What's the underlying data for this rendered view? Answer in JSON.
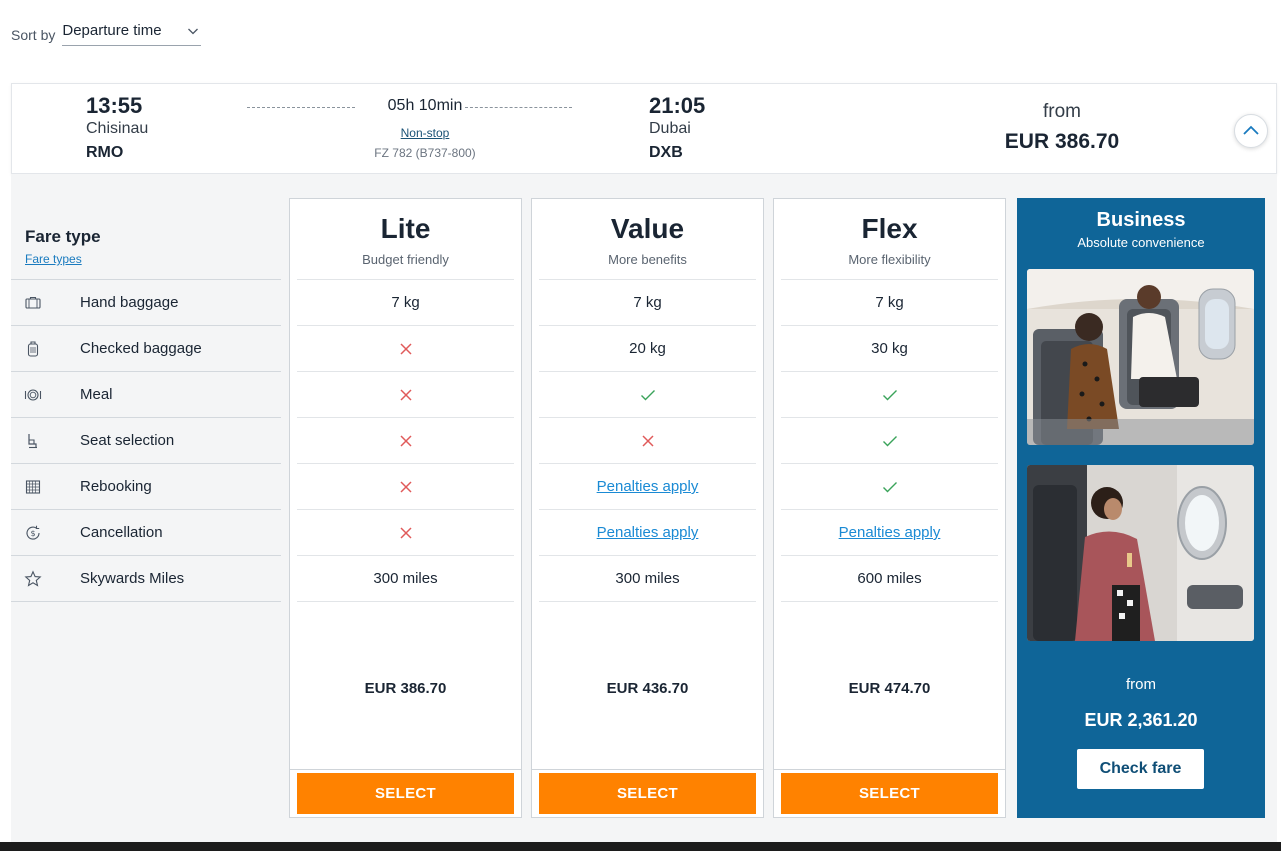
{
  "sort": {
    "label": "Sort by",
    "value": "Departure time"
  },
  "flight": {
    "departure": {
      "time": "13:55",
      "city": "Chisinau",
      "code": "RMO"
    },
    "arrival": {
      "time": "21:05",
      "city": "Dubai",
      "code": "DXB"
    },
    "duration": "05h 10min",
    "stops": "Non-stop",
    "flight_number": "FZ 782 (B737-800)",
    "from_label": "from",
    "from_price": "EUR 386.70"
  },
  "fare_header": {
    "title": "Fare type",
    "link": "Fare types"
  },
  "features": [
    {
      "label": "Hand baggage",
      "icon": "hand-baggage-icon"
    },
    {
      "label": "Checked baggage",
      "icon": "checked-baggage-icon"
    },
    {
      "label": "Meal",
      "icon": "meal-icon"
    },
    {
      "label": "Seat selection",
      "icon": "seat-icon"
    },
    {
      "label": "Rebooking",
      "icon": "calendar-icon"
    },
    {
      "label": "Cancellation",
      "icon": "refund-icon"
    },
    {
      "label": "Skywards Miles",
      "icon": "star-icon"
    }
  ],
  "fares": [
    {
      "name": "Lite",
      "subtitle": "Budget friendly",
      "cells": [
        {
          "text": "7 kg"
        },
        {
          "text": "",
          "icon": "cross-icon"
        },
        {
          "text": "",
          "icon": "cross-icon"
        },
        {
          "text": "",
          "icon": "cross-icon"
        },
        {
          "text": "",
          "icon": "cross-icon"
        },
        {
          "text": "",
          "icon": "cross-icon"
        },
        {
          "text": "300 miles"
        }
      ],
      "price": "EUR 386.70",
      "button": "SELECT"
    },
    {
      "name": "Value",
      "subtitle": "More benefits",
      "cells": [
        {
          "text": "7 kg"
        },
        {
          "text": "20 kg"
        },
        {
          "text": "",
          "icon": "check-icon"
        },
        {
          "text": "",
          "icon": "cross-icon"
        },
        {
          "text": "Penalties apply",
          "link": true
        },
        {
          "text": "Penalties apply",
          "link": true
        },
        {
          "text": "300 miles"
        }
      ],
      "price": "EUR 436.70",
      "button": "SELECT"
    },
    {
      "name": "Flex",
      "subtitle": "More flexibility",
      "cells": [
        {
          "text": "7 kg"
        },
        {
          "text": "30 kg"
        },
        {
          "text": "",
          "icon": "check-icon"
        },
        {
          "text": "",
          "icon": "check-icon"
        },
        {
          "text": "",
          "icon": "check-icon"
        },
        {
          "text": "Penalties apply",
          "link": true
        },
        {
          "text": "600 miles"
        }
      ],
      "price": "EUR 474.70",
      "button": "SELECT"
    }
  ],
  "business": {
    "title": "Business",
    "subtitle": "Absolute convenience",
    "from_label": "from",
    "price": "EUR 2,361.20",
    "button": "Check fare"
  },
  "colors": {
    "select_orange": "#ff8200",
    "business_blue": "#0f6598",
    "check_green": "#3aa35a",
    "cross_red": "#e05a5a",
    "link_blue": "#1a8ad4"
  }
}
